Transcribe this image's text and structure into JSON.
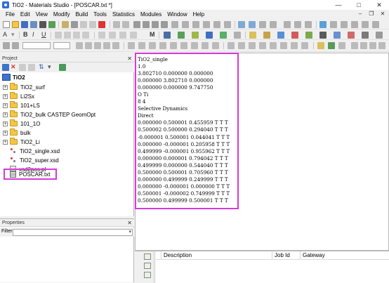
{
  "window": {
    "title": "TiO2 - Materials Studio - [POSCAR.txt *]"
  },
  "menu": [
    "File",
    "Edit",
    "View",
    "Modify",
    "Build",
    "Tools",
    "Statistics",
    "Modules",
    "Window",
    "Help"
  ],
  "toolbar": {
    "bold": "B",
    "italic": "I",
    "underline": "U",
    "find": "M"
  },
  "project": {
    "header": "Project",
    "root": "TiO2",
    "items": [
      {
        "label": "TiO2_surf",
        "type": "folder"
      },
      {
        "label": "Li2Sx",
        "type": "folder"
      },
      {
        "label": "101+LS",
        "type": "folder"
      },
      {
        "label": "TiO2_bulk CASTEP GeomOpt",
        "type": "folder"
      },
      {
        "label": "101_1O",
        "type": "folder"
      },
      {
        "label": "bulk",
        "type": "folder"
      },
      {
        "label": "TiO2_Li",
        "type": "folder"
      },
      {
        "label": "TiO2_single.xsd",
        "type": "xsd"
      },
      {
        "label": "TiO2_super.xsd",
        "type": "xsd"
      },
      {
        "label": "xsd2pos.pl",
        "type": "perl"
      },
      {
        "label": "POSCAR.txt",
        "type": "text"
      }
    ]
  },
  "properties": {
    "header": "Properties",
    "filter_label": "Filter:"
  },
  "document": {
    "lines": [
      "TiO2_single",
      "1.0",
      "3.802710 0.000000 0.000000",
      "0.000000 3.802710 0.000000",
      "0.000000 0.000000 9.747750",
      "O Ti",
      "8 4",
      "Selective Dynamics",
      "Direct",
      "0.000000 0.500001 0.455959 T T T",
      "0.500002 0.500000 0.294040 T T T",
      "-0.000001 0.500001 0.044041 T T T",
      "0.000000 -0.000001 0.205958 T T T",
      "0.499999 -0.000001 0.955962 T T T",
      "0.000000 0.000001 0.794042 T T T",
      "0.499999 0.000000 0.544040 T T T",
      "0.500000 0.500001 0.705960 T T T",
      "0.000000 0.499999 0.249999 T T T",
      "0.000000 -0.000001 0.000000 T T T",
      "0.500001 -0.000002 0.749999 T T T",
      "0.500000 0.499999 0.500001 T T T"
    ]
  },
  "jobs": {
    "columns": [
      "Description",
      "Job Id",
      "Gateway"
    ]
  },
  "colors": {
    "highlight": "#d63ad6",
    "folder": "#f3c64a"
  }
}
